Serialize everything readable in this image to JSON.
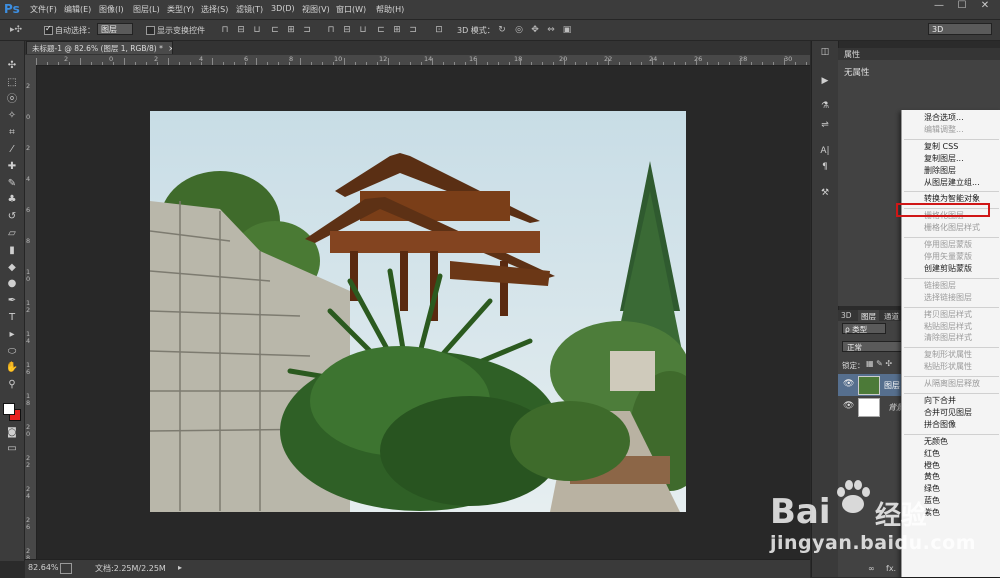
{
  "app": {
    "logo": "Ps"
  },
  "menubar": {
    "items": [
      "文件(F)",
      "编辑(E)",
      "图像(I)",
      "图层(L)",
      "类型(Y)",
      "选择(S)",
      "滤镜(T)",
      "3D(D)",
      "视图(V)",
      "窗口(W)",
      "帮助(H)"
    ],
    "window_controls": [
      "—",
      "☐",
      "✕"
    ]
  },
  "options": {
    "auto_select_label": "自动选择：",
    "auto_select_value": "图层",
    "transform_label": "显示变换控件",
    "mode_3d_label": "3D 模式：",
    "workspace_value": "3D"
  },
  "document": {
    "tab_title": "未标题-1 @ 82.6% (图层 1, RGB/8) *",
    "tab_close": "×",
    "ruler_top": [
      "2",
      "0",
      "2",
      "4",
      "6",
      "8",
      "10",
      "12",
      "14",
      "16",
      "18",
      "20",
      "22",
      "24",
      "26",
      "28",
      "30"
    ],
    "ruler_left": [
      "2",
      "0",
      "2",
      "4",
      "6",
      "8",
      "1\n0",
      "1\n2",
      "1\n4",
      "1\n6",
      "1\n8",
      "2\n0",
      "2\n2",
      "2\n4",
      "2\n6",
      "2\n8"
    ]
  },
  "statusbar": {
    "zoom": "82.64%",
    "doc_info": "文档:2.25M/2.25M"
  },
  "properties": {
    "tab_label": "属性",
    "content": "无属性"
  },
  "layers": {
    "tabs": [
      "3D",
      "图层",
      "通道"
    ],
    "filter_value": "ρ 类型",
    "blend_mode": "正常",
    "lock_label": "锁定：",
    "rows": [
      {
        "name": "图层",
        "selected": true
      },
      {
        "name": "背景",
        "selected": false
      }
    ],
    "footer_icons": [
      "∞",
      "fx."
    ]
  },
  "context_menu": {
    "items": [
      {
        "label": "混合选项...",
        "enabled": true
      },
      {
        "label": "编辑调整...",
        "enabled": false
      },
      {
        "sep": true
      },
      {
        "label": "复制 CSS",
        "enabled": true
      },
      {
        "label": "复制图层...",
        "enabled": true
      },
      {
        "label": "删除图层",
        "enabled": true
      },
      {
        "label": "从图层建立组...",
        "enabled": true
      },
      {
        "sep": true
      },
      {
        "label": "转换为智能对象",
        "enabled": true,
        "highlighted": true
      },
      {
        "sep": true
      },
      {
        "label": "栅格化图层",
        "enabled": false
      },
      {
        "label": "栅格化图层样式",
        "enabled": false
      },
      {
        "sep": true
      },
      {
        "label": "停用图层蒙版",
        "enabled": false
      },
      {
        "label": "停用矢量蒙版",
        "enabled": false
      },
      {
        "label": "创建剪贴蒙版",
        "enabled": true
      },
      {
        "sep": true
      },
      {
        "label": "链接图层",
        "enabled": false
      },
      {
        "label": "选择链接图层",
        "enabled": false
      },
      {
        "sep": true
      },
      {
        "label": "拷贝图层样式",
        "enabled": false
      },
      {
        "label": "粘贴图层样式",
        "enabled": false
      },
      {
        "label": "清除图层样式",
        "enabled": false
      },
      {
        "sep": true
      },
      {
        "label": "复制形状属性",
        "enabled": false
      },
      {
        "label": "粘贴形状属性",
        "enabled": false
      },
      {
        "sep": true
      },
      {
        "label": "从隔离图层释放",
        "enabled": false
      },
      {
        "sep": true
      },
      {
        "label": "向下合并",
        "enabled": true
      },
      {
        "label": "合并可见图层",
        "enabled": true
      },
      {
        "label": "拼合图像",
        "enabled": true
      },
      {
        "sep": true
      },
      {
        "label": "无颜色",
        "enabled": true
      },
      {
        "label": "红色",
        "enabled": true
      },
      {
        "label": "橙色",
        "enabled": true
      },
      {
        "label": "黄色",
        "enabled": true
      },
      {
        "label": "绿色",
        "enabled": true
      },
      {
        "label": "蓝色",
        "enabled": true
      },
      {
        "label": "紫色",
        "enabled": true
      }
    ]
  },
  "watermark": {
    "brand": "Bai",
    "brand_cn": "经验",
    "url": "jingyan.baidu.com"
  },
  "colors": {
    "highlight_border": "#d01616",
    "foreground_swatch": "#ffffff",
    "background_swatch": "#e8201f"
  }
}
